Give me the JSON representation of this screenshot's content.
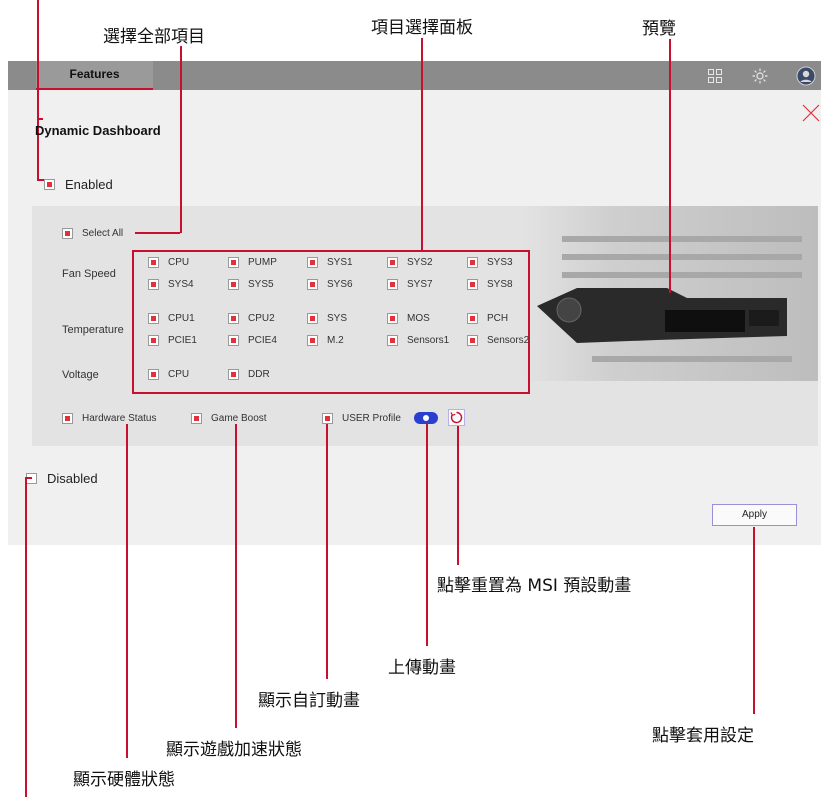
{
  "callouts": {
    "select_all": "選擇全部項目",
    "item_panel": "項目選擇面板",
    "preview": "預覽",
    "reset_msi": "點擊重置為 MSI 預設動畫",
    "upload": "上傳動畫",
    "user_animation": "顯示自訂動畫",
    "game_boost": "顯示遊戲加速狀態",
    "apply": "點擊套用設定",
    "hardware_status": "顯示硬體狀態"
  },
  "app": {
    "tab_label": "Features",
    "top_icons": [
      "grid-icon",
      "gear-icon",
      "avatar-icon"
    ],
    "title": "Dynamic Dashboard",
    "enabled_label": "Enabled",
    "disabled_label": "Disabled",
    "select_all_label": "Select All",
    "rows": [
      {
        "label": "Fan Speed",
        "items": [
          "CPU",
          "PUMP",
          "SYS1",
          "SYS2",
          "SYS3",
          "SYS4",
          "SYS5",
          "SYS6",
          "SYS7",
          "SYS8"
        ]
      },
      {
        "label": "Temperature",
        "items": [
          "CPU1",
          "CPU2",
          "SYS",
          "MOS",
          "PCH",
          "PCIE1",
          "PCIE4",
          "M.2",
          "Sensors1",
          "Sensors2"
        ]
      },
      {
        "label": "Voltage",
        "items": [
          "CPU",
          "DDR"
        ]
      }
    ],
    "hardware_status_label": "Hardware Status",
    "game_boost_label": "Game Boost",
    "user_profile_label": "USER Profile",
    "apply_label": "Apply"
  },
  "colors": {
    "accent_red": "#c8102e",
    "check_red": "#e0323a",
    "toggle_blue": "#2a3fd0"
  }
}
